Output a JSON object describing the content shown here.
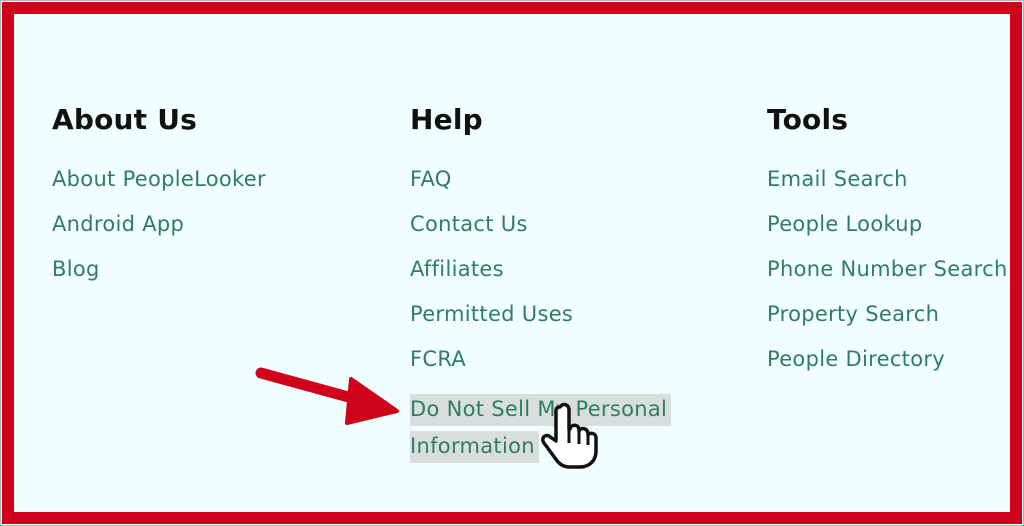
{
  "columns": {
    "about": {
      "heading": "About Us",
      "links": [
        "About PeopleLooker",
        "Android App",
        "Blog"
      ]
    },
    "help": {
      "heading": "Help",
      "links": [
        "FAQ",
        "Contact Us",
        "Affiliates",
        "Permitted Uses",
        "FCRA"
      ],
      "highlighted_line1": "Do Not Sell My Personal",
      "highlighted_line2": "Information"
    },
    "tools": {
      "heading": "Tools",
      "links": [
        "Email Search",
        "People Lookup",
        "Phone Number Search",
        "Property Search",
        "People Directory"
      ]
    }
  },
  "colors": {
    "border": "#d0021b",
    "background": "#f0fefd",
    "link": "#2f7d63",
    "heading": "#111111",
    "highlight": "#d8dedc"
  },
  "icons": {
    "annotation": "red-arrow-icon",
    "pointer": "hand-cursor-icon"
  }
}
